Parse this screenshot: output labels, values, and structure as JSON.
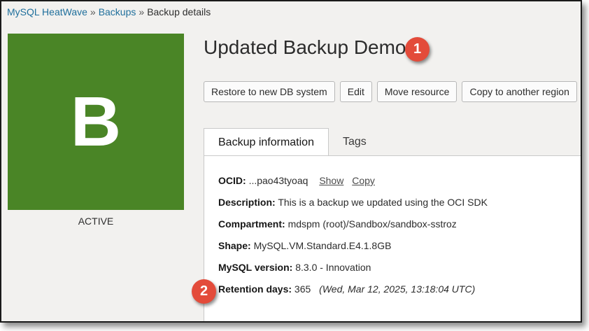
{
  "breadcrumb": {
    "items": [
      "MySQL HeatWave",
      "Backups",
      "Backup details"
    ],
    "separator": "»"
  },
  "resource": {
    "avatar_letter": "B",
    "avatar_color": "#4a8526",
    "status": "ACTIVE",
    "title": "Updated Backup Demo"
  },
  "actions": [
    "Restore to new DB system",
    "Edit",
    "Move resource",
    "Copy to another region"
  ],
  "tabs": [
    "Backup information",
    "Tags"
  ],
  "active_tab": "Backup information",
  "details": {
    "ocid": {
      "label": "OCID:",
      "value": "...pao43tyoaq",
      "show_link": "Show",
      "copy_link": "Copy"
    },
    "description": {
      "label": "Description:",
      "value": "This is a backup we updated using the OCI SDK"
    },
    "compartment": {
      "label": "Compartment:",
      "value": "mdspm (root)/Sandbox/sandbox-sstroz"
    },
    "shape": {
      "label": "Shape:",
      "value": "MySQL.VM.Standard.E4.1.8GB"
    },
    "mysql_version": {
      "label": "MySQL version:",
      "value": "8.3.0 - Innovation"
    },
    "retention_days": {
      "label": "Retention days:",
      "value": "365",
      "expiry": "(Wed, Mar 12, 2025, 13:18:04 UTC)"
    }
  },
  "callouts": [
    "1",
    "2"
  ],
  "colors": {
    "link": "#1f6f9c",
    "callout": "#e34b3a"
  }
}
